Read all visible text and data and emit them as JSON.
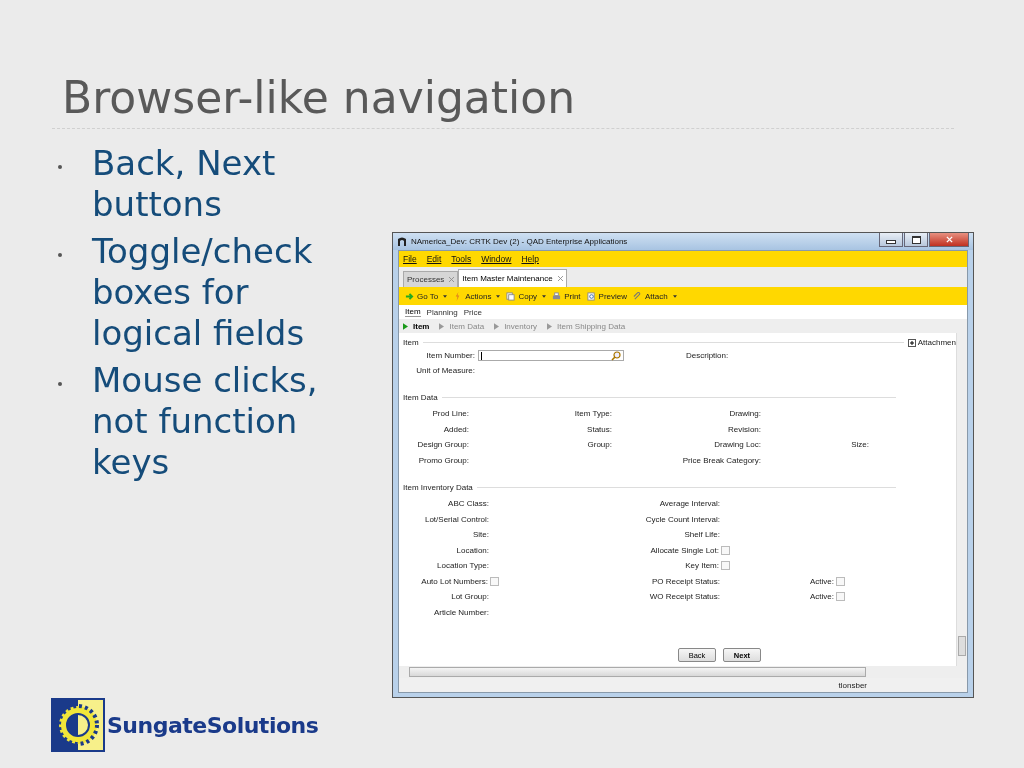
{
  "slide": {
    "title": "Browser-like navigation",
    "bullets": [
      "Back, Next buttons",
      "Toggle/check boxes for logical fields",
      "Mouse clicks, not function keys"
    ],
    "logo": "SungateSolutions"
  },
  "window": {
    "title": "NAmerica_Dev: CRTK Dev (2) - QAD Enterprise Applications",
    "menu": [
      "File",
      "Edit",
      "Tools",
      "Window",
      "Help"
    ],
    "tabs": [
      {
        "label": "Processes",
        "selected": false
      },
      {
        "label": "Item Master Maintenance",
        "selected": true
      }
    ],
    "toolbar": [
      {
        "label": "Go To",
        "kind": "goto",
        "dropdown": true
      },
      {
        "label": "Actions",
        "kind": "actions",
        "dropdown": true
      },
      {
        "label": "Copy",
        "kind": "copy",
        "dropdown": true
      },
      {
        "label": "Print",
        "kind": "print",
        "dropdown": false
      },
      {
        "label": "Preview",
        "kind": "preview",
        "dropdown": false
      },
      {
        "label": "Attach",
        "kind": "attach",
        "dropdown": true
      }
    ],
    "subtabs": [
      {
        "label": "Item",
        "selected": true
      },
      {
        "label": "Planning",
        "selected": false
      },
      {
        "label": "Price",
        "selected": false
      }
    ],
    "steps": [
      {
        "label": "Item",
        "selected": true
      },
      {
        "label": "Item Data",
        "selected": false
      },
      {
        "label": "Inventory",
        "selected": false
      },
      {
        "label": "Item Shipping Data",
        "selected": false
      }
    ],
    "item_group": "Item",
    "attachments": "Attachmen",
    "item_number_label": "Item Number:",
    "description_label": "Description:",
    "unit_label": "Unit of Measure:",
    "sections": [
      {
        "title": "Item Data",
        "rows": [
          [
            {
              "label": "Prod Line:"
            },
            {
              "label": "Item Type:"
            },
            {
              "label": "Drawing:"
            },
            ""
          ],
          [
            {
              "label": "Added:"
            },
            {
              "label": "Status:"
            },
            {
              "label": "Revision:"
            },
            ""
          ],
          [
            {
              "label": "Design Group:"
            },
            {
              "label": "Group:"
            },
            {
              "label": "Drawing Loc:"
            },
            {
              "label": "Size:"
            }
          ],
          [
            {
              "label": "Promo Group:"
            },
            "",
            {
              "label": "Price Break Category:"
            },
            ""
          ]
        ]
      },
      {
        "title": "Item Inventory Data",
        "rows": [
          [
            {
              "label": "ABC Class:"
            },
            {
              "label": "Average Interval:"
            },
            ""
          ],
          [
            {
              "label": "Lot/Serial Control:"
            },
            {
              "label": "Cycle Count Interval:"
            },
            ""
          ],
          [
            {
              "label": "Site:"
            },
            {
              "label": "Shelf Life:"
            },
            ""
          ],
          [
            {
              "label": "Location:"
            },
            {
              "label": "Allocate Single Lot:",
              "checked": false
            },
            ""
          ],
          [
            {
              "label": "Location Type:"
            },
            {
              "label": "Key Item:",
              "checked": false
            },
            ""
          ],
          [
            {
              "label": "Auto Lot Numbers:",
              "checked": false
            },
            {
              "label": "PO Receipt Status:"
            },
            {
              "label": "Active:",
              "checked": false
            }
          ],
          [
            {
              "label": "Lot Group:"
            },
            {
              "label": "WO Receipt Status:"
            },
            {
              "label": "Active:",
              "checked": false
            }
          ],
          [
            {
              "label": "Article Number:"
            },
            "",
            ""
          ]
        ]
      }
    ],
    "buttons": [
      {
        "label": "Back",
        "default": false
      },
      {
        "label": "Next",
        "default": true
      }
    ],
    "status_user": "tlonsber"
  }
}
